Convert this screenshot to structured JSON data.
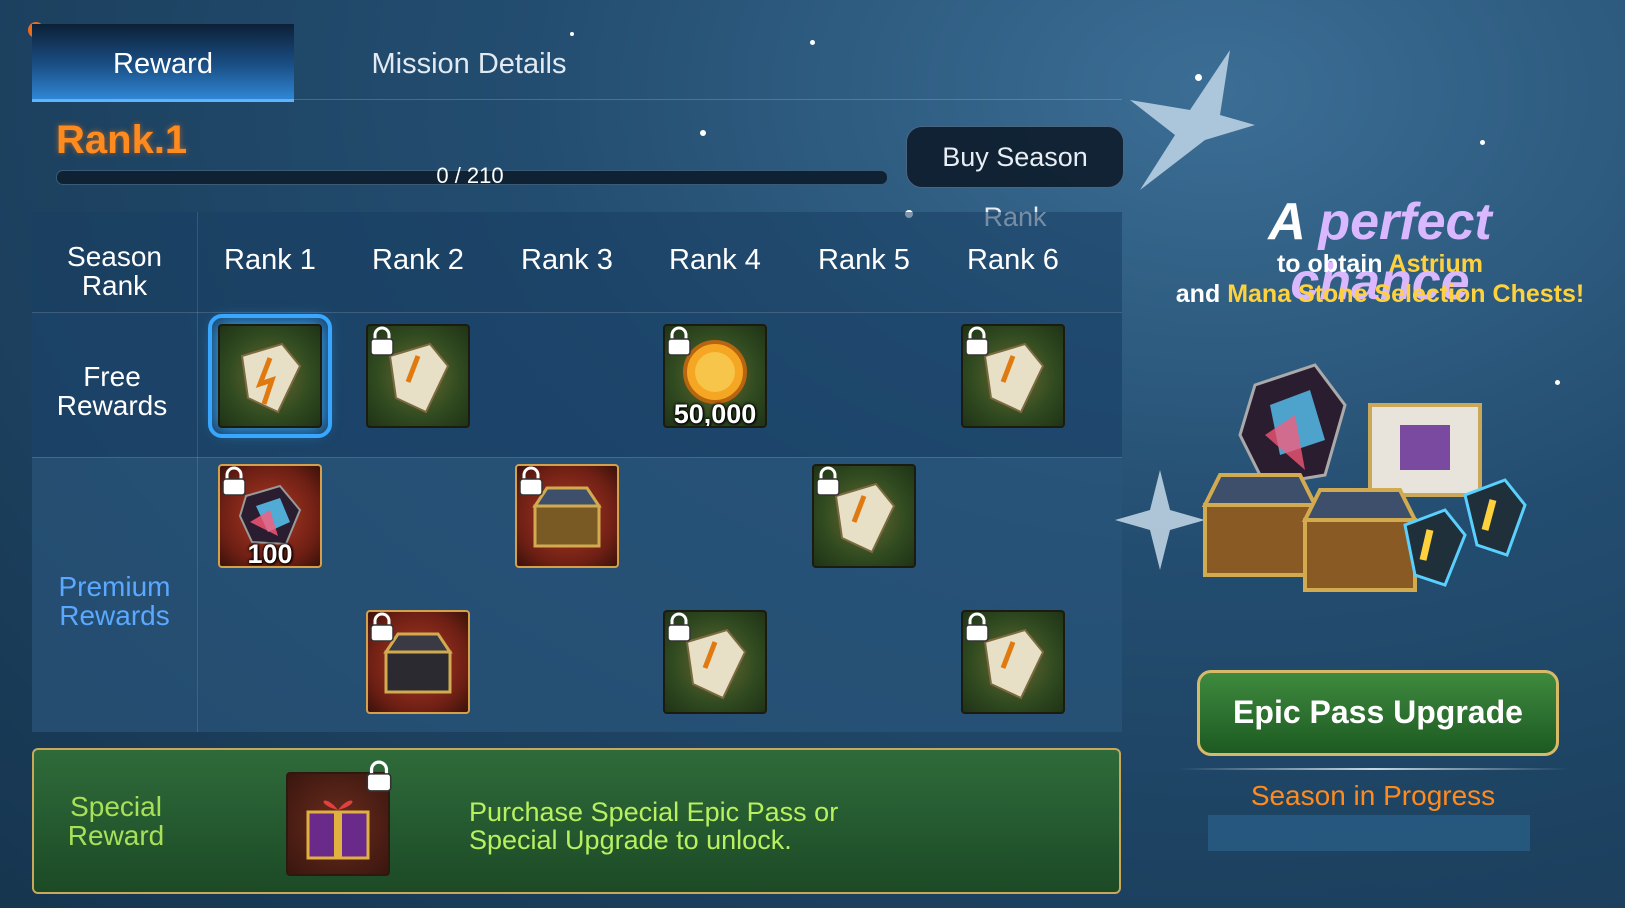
{
  "tabs": {
    "reward": "Reward",
    "mission_details": "Mission Details"
  },
  "rank": {
    "title": "Rank.1",
    "progress_text": "0 / 210",
    "progress_fraction": 0.0
  },
  "buy_button": "Buy Season Rank",
  "table": {
    "season_rank_label": "Season Rank",
    "ranks": [
      "Rank 1",
      "Rank 2",
      "Rank 3",
      "Rank 4",
      "Rank 5",
      "Rank 6"
    ],
    "free_label": "Free Rewards",
    "premium_label": "Premium Rewards",
    "free_items": {
      "rank4_qty": "50,000"
    },
    "premium_items": {
      "rank1_qty": "100"
    }
  },
  "special": {
    "label": "Special Reward",
    "text_line1": "Purchase Special Epic Pass or",
    "text_line2": "Special Upgrade to unlock."
  },
  "promo": {
    "title_a": "A",
    "title_b": "perfect chance",
    "line1_pre": "to obtain",
    "line1_hl": "Astrium",
    "line2_pre": "and",
    "line2_hl": "Mana Stone Selection Chests!"
  },
  "epic_button": "Epic Pass Upgrade",
  "season_status": "Season in Progress",
  "colors": {
    "accent_orange": "#ff8a1e",
    "tab_blue": "#2f86d4",
    "special_green": "#b8f060",
    "premium_blue": "#5aa8ff"
  }
}
